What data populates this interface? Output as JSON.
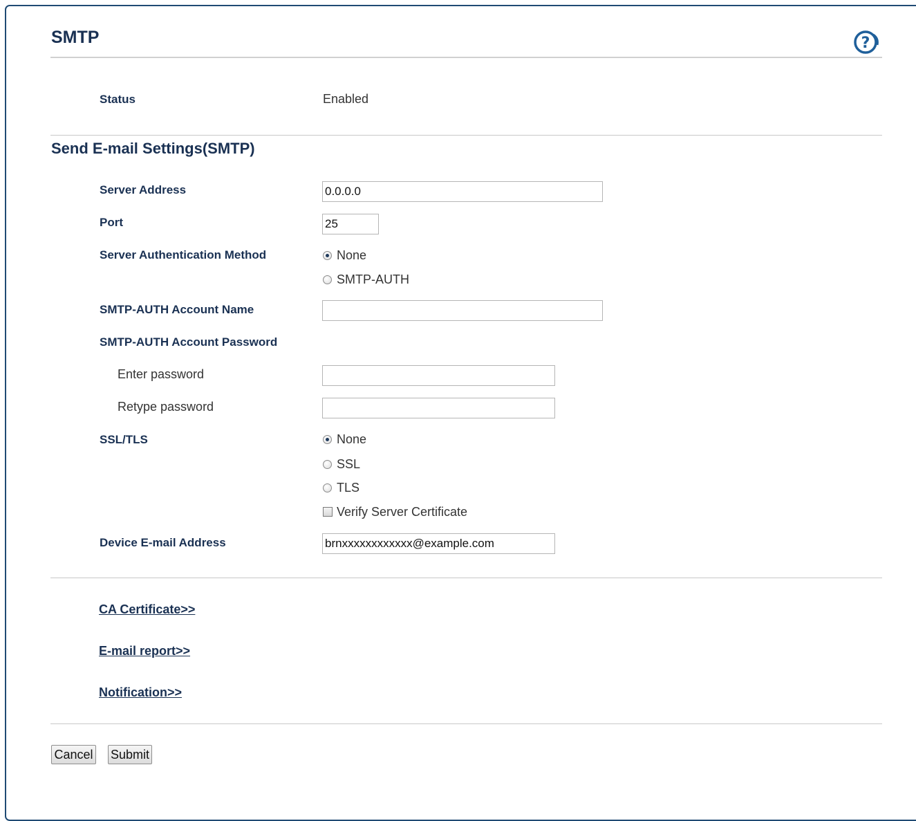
{
  "page": {
    "title": "SMTP",
    "help_icon": "help-icon"
  },
  "status": {
    "label": "Status",
    "value": "Enabled"
  },
  "send_settings": {
    "title": "Send E-mail Settings(SMTP)",
    "server_address": {
      "label": "Server Address",
      "value": "0.0.0.0"
    },
    "port": {
      "label": "Port",
      "value": "25"
    },
    "auth_method": {
      "label": "Server Authentication Method",
      "options": [
        "None",
        "SMTP-AUTH"
      ],
      "selected": "None"
    },
    "account_name": {
      "label": "SMTP-AUTH Account Name",
      "value": ""
    },
    "account_password": {
      "label": "SMTP-AUTH Account Password",
      "enter_label": "Enter password",
      "retype_label": "Retype password",
      "enter_value": "",
      "retype_value": ""
    },
    "ssl_tls": {
      "label": "SSL/TLS",
      "options": [
        "None",
        "SSL",
        "TLS"
      ],
      "selected": "None",
      "verify_label": "Verify Server Certificate",
      "verify_checked": false
    },
    "device_email": {
      "label": "Device E-mail Address",
      "value": "brnxxxxxxxxxxxx@example.com"
    }
  },
  "links": {
    "ca_certificate": "CA Certificate>>",
    "email_report": "E-mail report>>",
    "notification": "Notification>>"
  },
  "buttons": {
    "cancel": "Cancel",
    "submit": "Submit"
  },
  "colors": {
    "heading": "#1a3153",
    "frame": "#1f4a73",
    "help_icon": "#1f5f9a"
  }
}
